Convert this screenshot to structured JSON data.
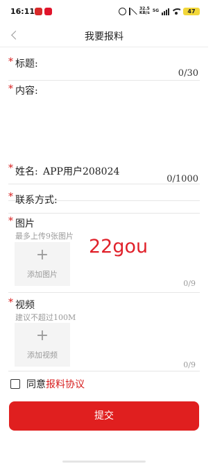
{
  "status_bar": {
    "time": "16:11",
    "net_speed_value": "32.5",
    "net_speed_unit": "KB/s",
    "network": "5G",
    "battery": "47"
  },
  "header": {
    "title": "我要报料"
  },
  "form": {
    "required_mark": "*",
    "title_field": {
      "label": "标题:",
      "counter": "0/30"
    },
    "content_field": {
      "label": "内容:",
      "counter": "0/1000"
    },
    "name_field": {
      "label": "姓名:",
      "value": "APP用户208024"
    },
    "contact_field": {
      "label": "联系方式:"
    },
    "images_field": {
      "label": "图片",
      "hint": "最多上传9张图片",
      "add_label": "添加图片",
      "plus": "+",
      "counter": "0/9"
    },
    "video_field": {
      "label": "视频",
      "hint": "建议不超过100M",
      "add_label": "添加视频",
      "plus": "+",
      "counter": "0/9"
    }
  },
  "watermark": "22gou",
  "agreement": {
    "text": "同意",
    "link": "报料协议"
  },
  "submit_label": "提交",
  "colors": {
    "accent": "#e01f1f",
    "required": "#d71d1d"
  }
}
